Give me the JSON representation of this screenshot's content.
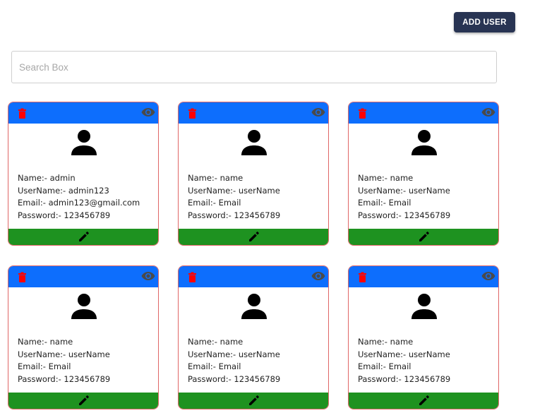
{
  "toolbar": {
    "add_user_label": "ADD USER"
  },
  "search": {
    "placeholder": "Search Box",
    "value": ""
  },
  "colors": {
    "header_bg": "#0d6efd",
    "footer_bg": "#1e9220",
    "card_border": "#e06666",
    "delete_icon": "#ff0000",
    "view_icon": "#4a4a4a",
    "add_user_bg": "#283453"
  },
  "icons": {
    "delete": "trash-icon",
    "view": "eye-icon",
    "avatar": "person-icon",
    "edit": "pencil-icon"
  },
  "users": [
    {
      "name": "Name:- admin",
      "username": "UserName:- admin123",
      "email": "Email:- admin123@gmail.com",
      "password": "Password:- 123456789"
    },
    {
      "name": "Name:- name",
      "username": "UserName:- userName",
      "email": "Email:- Email",
      "password": "Password:- 123456789"
    },
    {
      "name": "Name:- name",
      "username": "UserName:- userName",
      "email": "Email:- Email",
      "password": "Password:- 123456789"
    },
    {
      "name": "Name:- name",
      "username": "UserName:- userName",
      "email": "Email:- Email",
      "password": "Password:- 123456789"
    },
    {
      "name": "Name:- name",
      "username": "UserName:- userName",
      "email": "Email:- Email",
      "password": "Password:- 123456789"
    },
    {
      "name": "Name:- name",
      "username": "UserName:- userName",
      "email": "Email:- Email",
      "password": "Password:- 123456789"
    }
  ]
}
